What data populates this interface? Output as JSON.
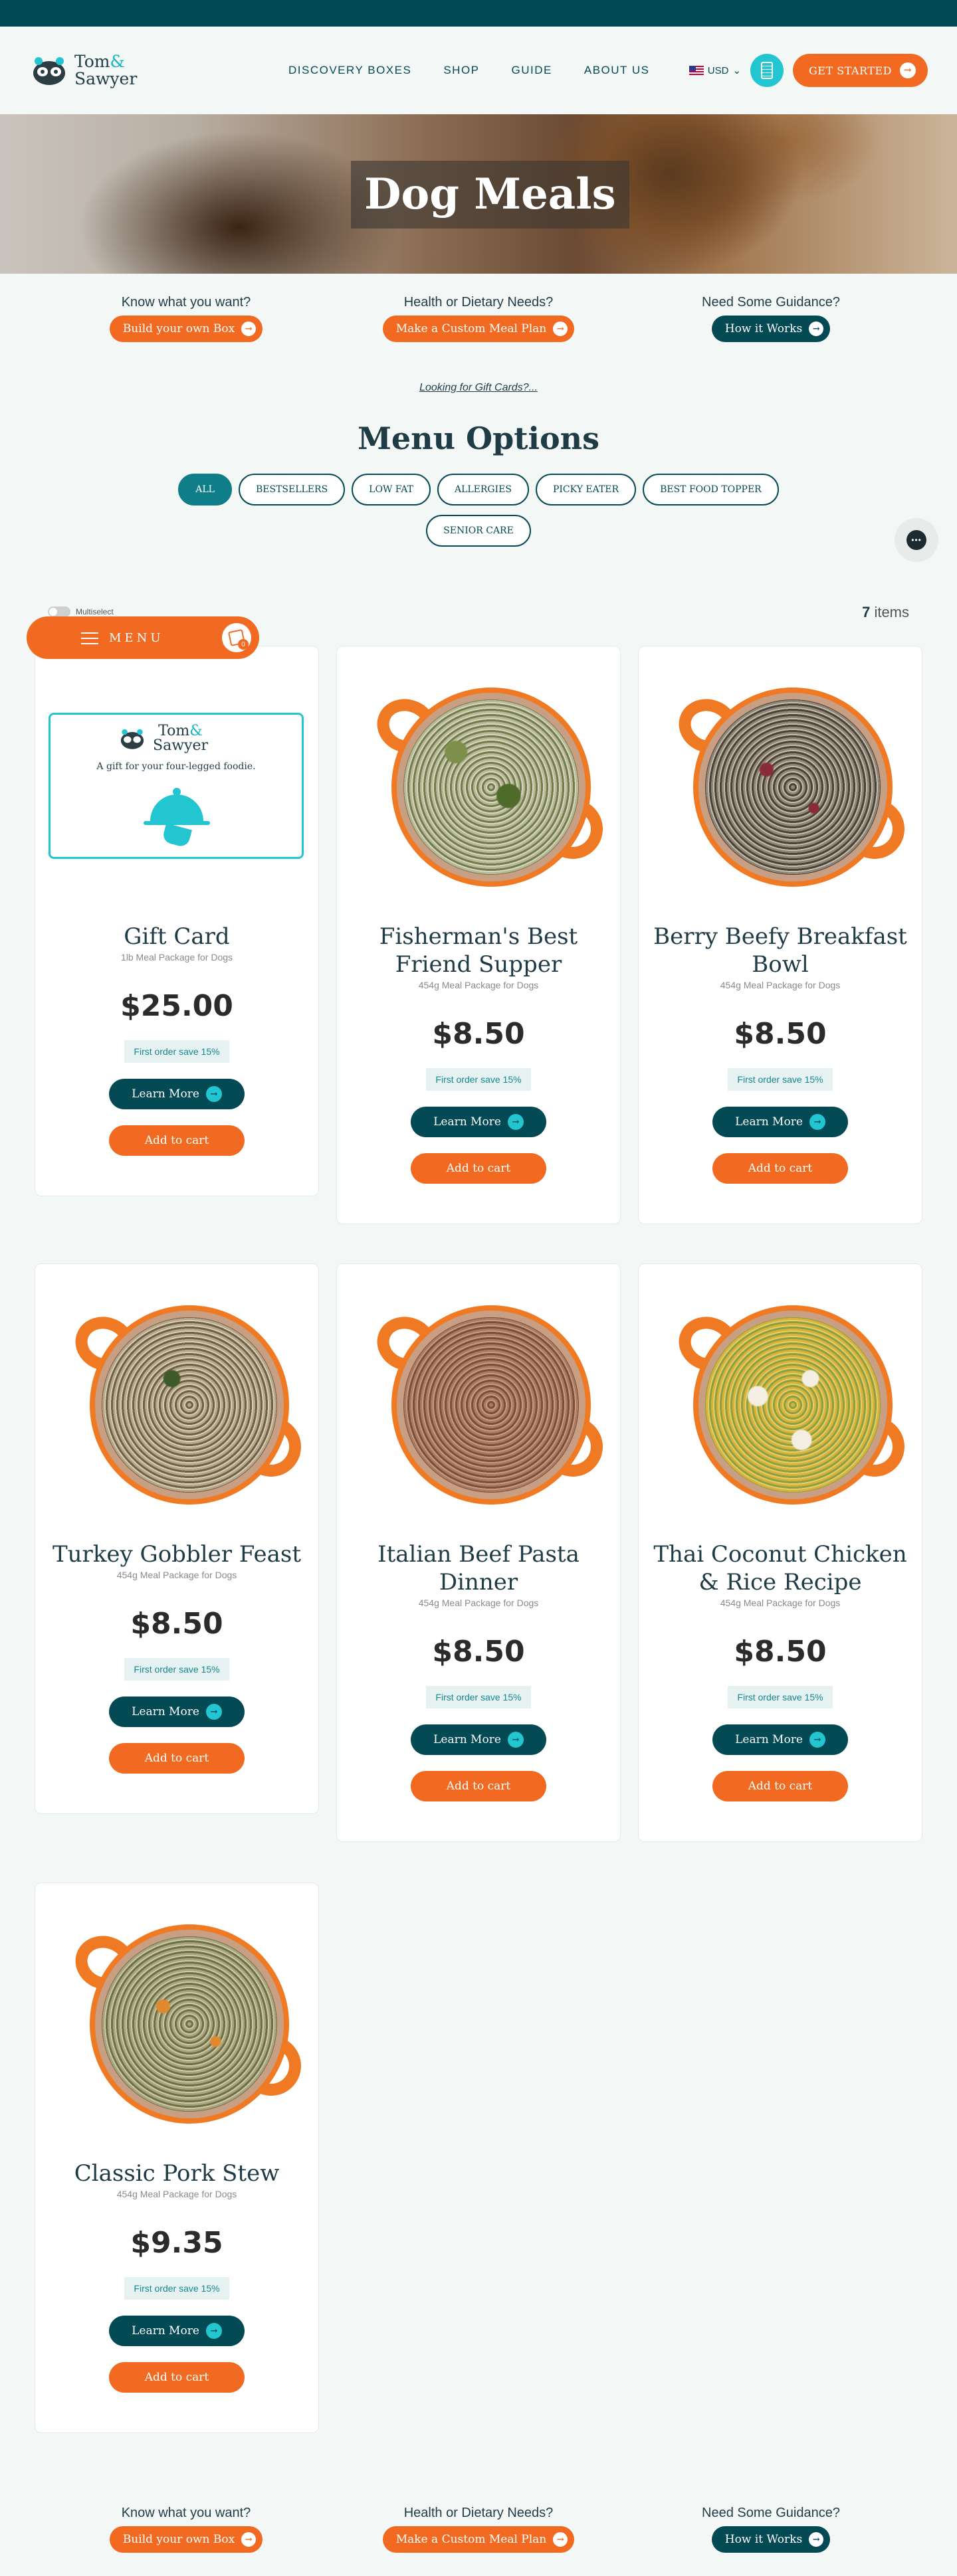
{
  "header": {
    "logo": {
      "line1": "Tom",
      "amp": "&",
      "line2": "Sawyer"
    },
    "nav": [
      "DISCOVERY BOXES",
      "SHOP",
      "GUIDE",
      "ABOUT US"
    ],
    "currency": "USD",
    "cta": "GET STARTED"
  },
  "hero": {
    "title": "Dog Meals"
  },
  "guides": [
    {
      "question": "Know what you want?",
      "button": "Build your own Box",
      "style": "orange"
    },
    {
      "question": "Health or Dietary Needs?",
      "button": "Make a Custom Meal Plan",
      "style": "orange"
    },
    {
      "question": "Need Some Guidance?",
      "button": "How it Works",
      "style": "teal"
    }
  ],
  "gift_link": "Looking for Gift Cards?...",
  "menu_title": "Menu Options",
  "filters": [
    "ALL",
    "BESTSELLERS",
    "LOW FAT",
    "ALLERGIES",
    "PICKY EATER",
    "BEST FOOD TOPPER",
    "SENIOR CARE"
  ],
  "active_filter": "ALL",
  "list_meta": {
    "multiselect": "Multiselect",
    "count": "7",
    "count_label": "items"
  },
  "menu_float": {
    "label": "MENU",
    "cart_count": "0"
  },
  "gift_card_art": {
    "tagline": "A gift for your four-legged foodie."
  },
  "products": [
    {
      "name": "Gift Card",
      "sub": "1lb Meal Package for Dogs",
      "price": "$25.00",
      "save": "First order save 15%",
      "learn": "Learn More",
      "cart": "Add to cart"
    },
    {
      "name": "Fisherman's Best Friend Supper",
      "sub": "454g Meal Package for Dogs",
      "price": "$8.50",
      "save": "First order save 15%",
      "learn": "Learn More",
      "cart": "Add to cart"
    },
    {
      "name": "Berry Beefy Breakfast Bowl",
      "sub": "454g Meal Package for Dogs",
      "price": "$8.50",
      "save": "First order save 15%",
      "learn": "Learn More",
      "cart": "Add to cart"
    },
    {
      "name": "Turkey Gobbler Feast",
      "sub": "454g Meal Package for Dogs",
      "price": "$8.50",
      "save": "First order save 15%",
      "learn": "Learn More",
      "cart": "Add to cart"
    },
    {
      "name": "Italian Beef Pasta Dinner",
      "sub": "454g Meal Package for Dogs",
      "price": "$8.50",
      "save": "First order save 15%",
      "learn": "Learn More",
      "cart": "Add to cart"
    },
    {
      "name": "Thai Coconut Chicken & Rice Recipe",
      "sub": "454g Meal Package for Dogs",
      "price": "$8.50",
      "save": "First order save 15%",
      "learn": "Learn More",
      "cart": "Add to cart"
    },
    {
      "name": "Classic Pork Stew",
      "sub": "454g Meal Package for Dogs",
      "price": "$9.35",
      "save": "First order save 15%",
      "learn": "Learn More",
      "cart": "Add to cart"
    }
  ],
  "colors": {
    "brand_teal": "#044a55",
    "accent_orange": "#f26a21",
    "accent_cyan": "#22c5d0"
  }
}
